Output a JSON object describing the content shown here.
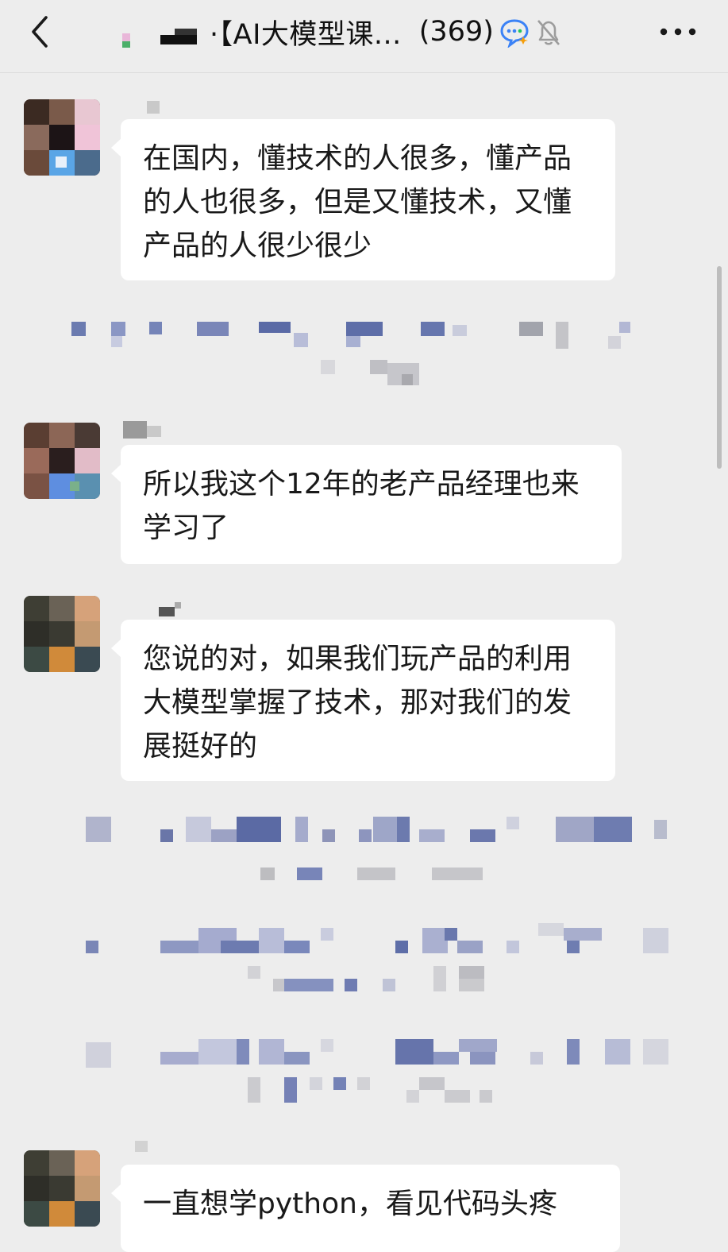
{
  "header": {
    "title": "·【AI大模型课...",
    "member_count": "(369)",
    "back_icon": "chevron-left-icon",
    "ai_icon": "ai-assistant-icon",
    "mute_icon": "bell-off-icon",
    "more_icon": "more-dots-icon"
  },
  "messages": [
    {
      "text": "在国内，懂技术的人很多，懂产品的人也很多，但是又懂技术，又懂产品的人很少很少"
    },
    {
      "text": "所以我这个12年的老产品经理也来学习了"
    },
    {
      "text": "您说的对，如果我们玩产品的利用大模型掌握了技术，那对我们的发展挺好的"
    },
    {
      "text": "一直想学python，看见代码头疼"
    }
  ],
  "colors": {
    "background": "#ededed",
    "bubble": "#ffffff",
    "text": "#191919"
  }
}
